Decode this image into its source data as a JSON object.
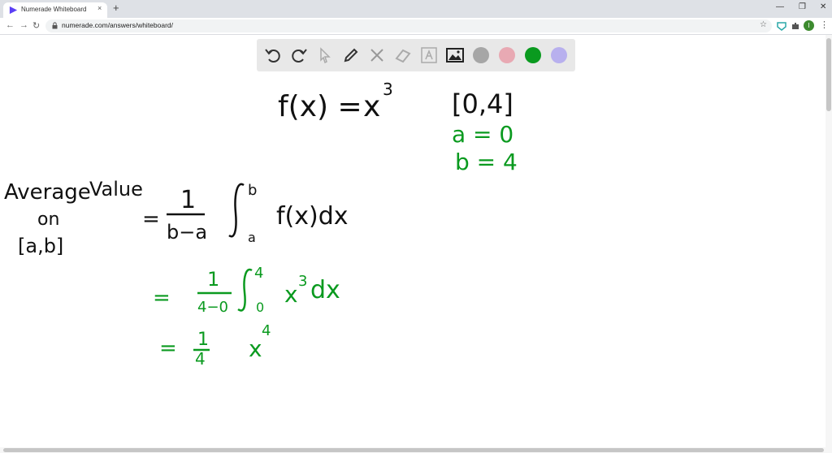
{
  "browser": {
    "tab_title": "Numerade Whiteboard",
    "url": "numerade.com/answers/whiteboard/",
    "new_tab": "+",
    "close": "×",
    "profile_initial": "I"
  },
  "toolbar": {
    "tools": [
      "undo-icon",
      "redo-icon",
      "pointer-icon",
      "pen-icon",
      "tools-icon",
      "eraser-icon",
      "text-icon",
      "image-icon"
    ],
    "colors": [
      "#a6a6a6",
      "#e8a9b3",
      "#0a9a1f",
      "#b8b0ee"
    ]
  },
  "math": {
    "fx_lhs": "f(x) =",
    "fx_rhs": "x",
    "fx_exp": "3",
    "interval": "[0,4]",
    "a_def": "a = 0",
    "b_def": "b = 4",
    "avg_word1": "Average",
    "avg_word2": "Value",
    "avg_on": "on",
    "avg_interval": "[a,b]",
    "eq1_eq": "=",
    "eq1_num": "1",
    "eq1_den": "b−a",
    "eq1_upper": "b",
    "eq1_lower": "a",
    "eq1_body": "f(x)dx",
    "eq2_eq": "=",
    "eq2_num": "1",
    "eq2_den": "4−0",
    "eq2_upper": "4",
    "eq2_lower": "0",
    "eq2_body": "x",
    "eq2_exp": "3",
    "eq2_dx": "dx",
    "eq3_eq": "=",
    "eq3_num": "1",
    "eq3_den": "4",
    "eq3_body": "x",
    "eq3_exp": "4"
  }
}
